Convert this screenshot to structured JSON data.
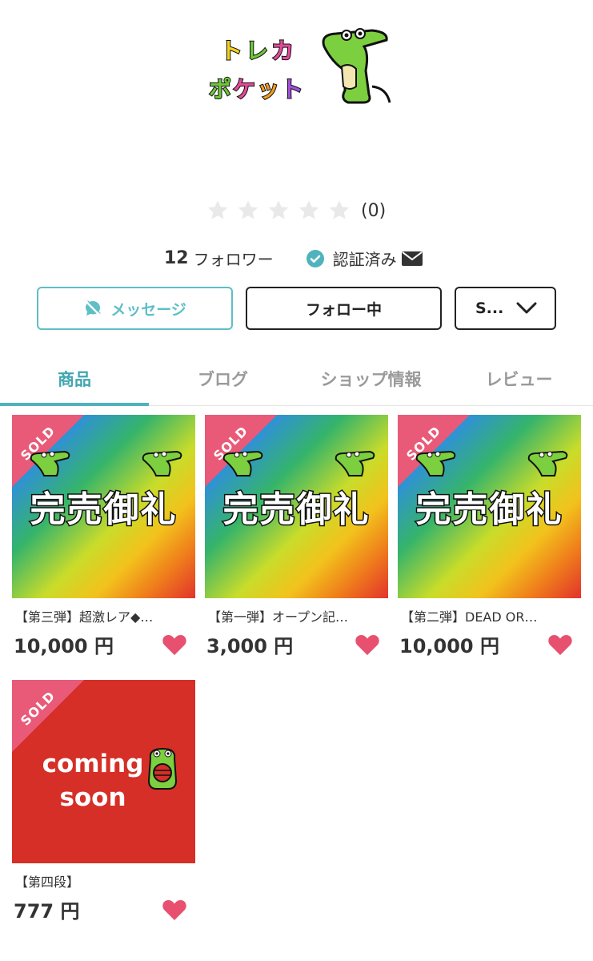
{
  "logo": {
    "row1": [
      "ト",
      "レ",
      "カ"
    ],
    "row2": [
      "ポ",
      "ケ",
      "ッ",
      "ト"
    ]
  },
  "rating": {
    "stars_filled": 0,
    "stars_total": 5,
    "count_text": "(0)"
  },
  "stats": {
    "followers_count": "12",
    "followers_label": "フォロワー",
    "verified_label": "認証済み"
  },
  "buttons": {
    "message": "メッセージ",
    "follow": "フォロー中",
    "select": "S..."
  },
  "tabs": [
    {
      "label": "商品",
      "active": true
    },
    {
      "label": "ブログ",
      "active": false
    },
    {
      "label": "ショップ情報",
      "active": false
    },
    {
      "label": "レビュー",
      "active": false
    }
  ],
  "products": [
    {
      "badge": "SOLD",
      "image_text": "完売御礼",
      "title": "【第三弾】超激レア◆…",
      "price": "10,000 円"
    },
    {
      "badge": "SOLD",
      "image_text": "完売御礼",
      "title": "【第一弾】オープン記…",
      "price": "3,000 円"
    },
    {
      "badge": "SOLD",
      "image_text": "完売御礼",
      "title": "【第二弾】DEAD OR…",
      "price": "10,000 円"
    },
    {
      "badge": "SOLD",
      "image_text_line1": "coming",
      "image_text_line2": "soon",
      "title": "【第四段】",
      "price": "777 円"
    }
  ],
  "colors": {
    "accent": "#4fb3bd",
    "sold_badge": "#e95a78",
    "heart": "#e8506f",
    "coming_soon_bg": "#d52f27"
  },
  "icons": {
    "star": "star-icon",
    "verified": "check-circle-icon",
    "mail": "mail-icon",
    "message": "no-chat-icon",
    "chevron": "chevron-down-icon",
    "heart": "heart-icon"
  }
}
